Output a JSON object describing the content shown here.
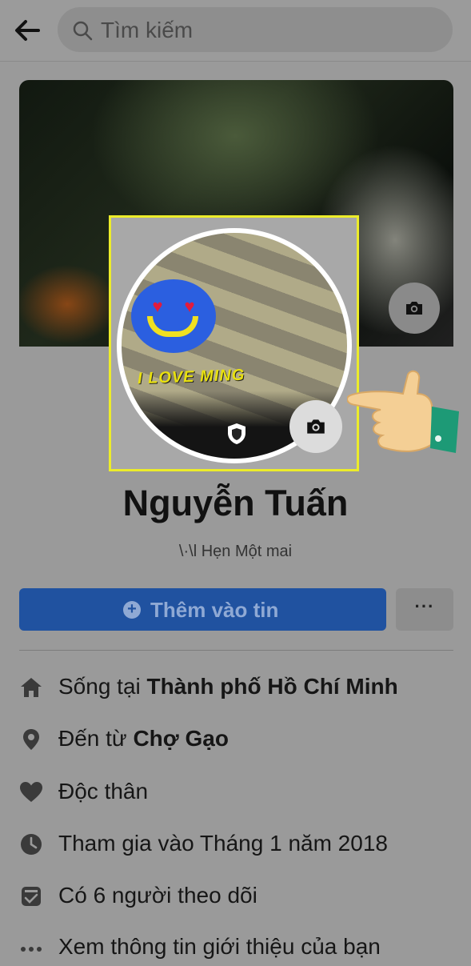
{
  "search": {
    "placeholder": "Tìm kiếm"
  },
  "profile": {
    "name": "Nguyễn Tuấn",
    "bio": "\\·\\l Hẹn Một mai",
    "avatar_caption": "I LOVE MING"
  },
  "actions": {
    "add_story_label": "Thêm vào tin",
    "more_label": "···"
  },
  "info": [
    {
      "icon": "home-icon",
      "prefix": "Sống tại ",
      "strong": "Thành phố Hồ Chí Minh"
    },
    {
      "icon": "location-pin-icon",
      "prefix": "Đến từ ",
      "strong": "Chợ Gạo"
    },
    {
      "icon": "heart-icon",
      "prefix": "Độc thân",
      "strong": ""
    },
    {
      "icon": "clock-icon",
      "prefix": "Tham gia vào Tháng 1 năm 2018",
      "strong": ""
    },
    {
      "icon": "followers-icon",
      "prefix": "Có 6 người theo dõi",
      "strong": ""
    },
    {
      "icon": "more-dots-icon",
      "prefix": "Xem thông tin giới thiệu của bạn",
      "strong": ""
    }
  ],
  "colors": {
    "primary_button": "#2052a0",
    "highlight": "#ecec2a",
    "overlay_gray": "#9a9a9a"
  }
}
